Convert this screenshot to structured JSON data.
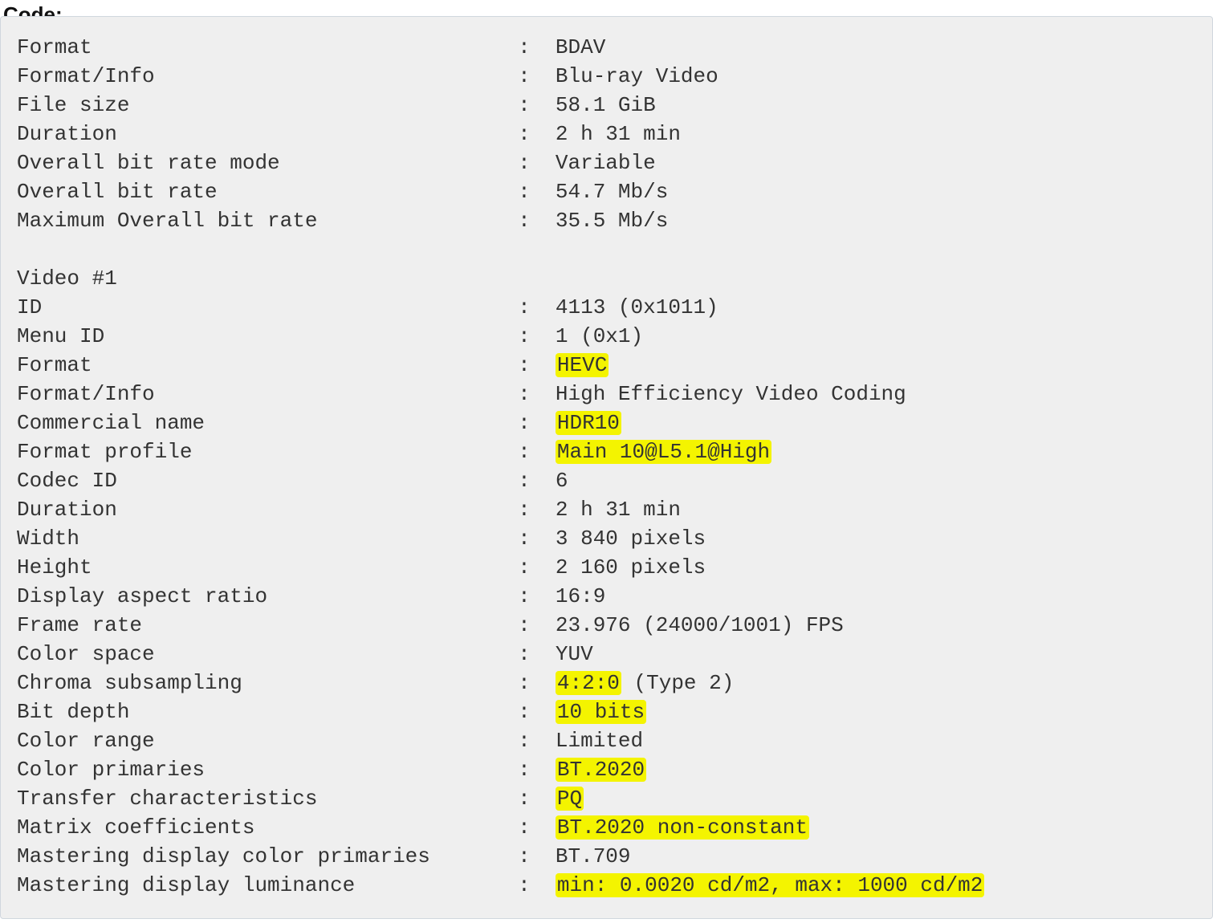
{
  "header_label": "Code:",
  "separator": ": ",
  "general": [
    {
      "key": "Format",
      "val": "BDAV",
      "hl": false
    },
    {
      "key": "Format/Info",
      "val": "Blu-ray Video",
      "hl": false
    },
    {
      "key": "File size",
      "val": "58.1 GiB",
      "hl": false
    },
    {
      "key": "Duration",
      "val": "2 h 31 min",
      "hl": false
    },
    {
      "key": "Overall bit rate mode",
      "val": "Variable",
      "hl": false
    },
    {
      "key": "Overall bit rate",
      "val": "54.7 Mb/s",
      "hl": false
    },
    {
      "key": "Maximum Overall bit rate",
      "val": "35.5 Mb/s",
      "hl": false
    }
  ],
  "section2_title": "Video #1",
  "video": [
    {
      "key": "ID",
      "val": "4113 (0x1011)",
      "hl": false
    },
    {
      "key": "Menu ID",
      "val": "1 (0x1)",
      "hl": false
    },
    {
      "key": "Format",
      "val": "HEVC",
      "hl": true
    },
    {
      "key": "Format/Info",
      "val": "High Efficiency Video Coding",
      "hl": false
    },
    {
      "key": "Commercial name",
      "val": "HDR10",
      "hl": true
    },
    {
      "key": "Format profile",
      "val": "Main 10@L5.1@High",
      "hl": true
    },
    {
      "key": "Codec ID",
      "val": "6",
      "hl": false
    },
    {
      "key": "Duration",
      "val": "2 h 31 min",
      "hl": false
    },
    {
      "key": "Width",
      "val": "3 840 pixels",
      "hl": false
    },
    {
      "key": "Height",
      "val": "2 160 pixels",
      "hl": false
    },
    {
      "key": "Display aspect ratio",
      "val": "16:9",
      "hl": false
    },
    {
      "key": "Frame rate",
      "val": "23.976 (24000/1001) FPS",
      "hl": false
    },
    {
      "key": "Color space",
      "val": "YUV",
      "hl": false
    },
    {
      "key": "Chroma subsampling",
      "segments": [
        {
          "text": "4:2:0",
          "hl": true
        },
        {
          "text": " (Type 2)",
          "hl": false
        }
      ]
    },
    {
      "key": "Bit depth",
      "val": "10 bits",
      "hl": true
    },
    {
      "key": "Color range",
      "val": "Limited",
      "hl": false
    },
    {
      "key": "Color primaries",
      "val": "BT.2020",
      "hl": true
    },
    {
      "key": "Transfer characteristics",
      "val": "PQ",
      "hl": true
    },
    {
      "key": "Matrix coefficients",
      "val": "BT.2020 non-constant",
      "hl": true
    },
    {
      "key": "Mastering display color primaries",
      "val": "BT.709",
      "hl": false
    },
    {
      "key": "Mastering display luminance",
      "val": "min: 0.0020 cd/m2, max: 1000 cd/m2",
      "hl": true
    }
  ]
}
